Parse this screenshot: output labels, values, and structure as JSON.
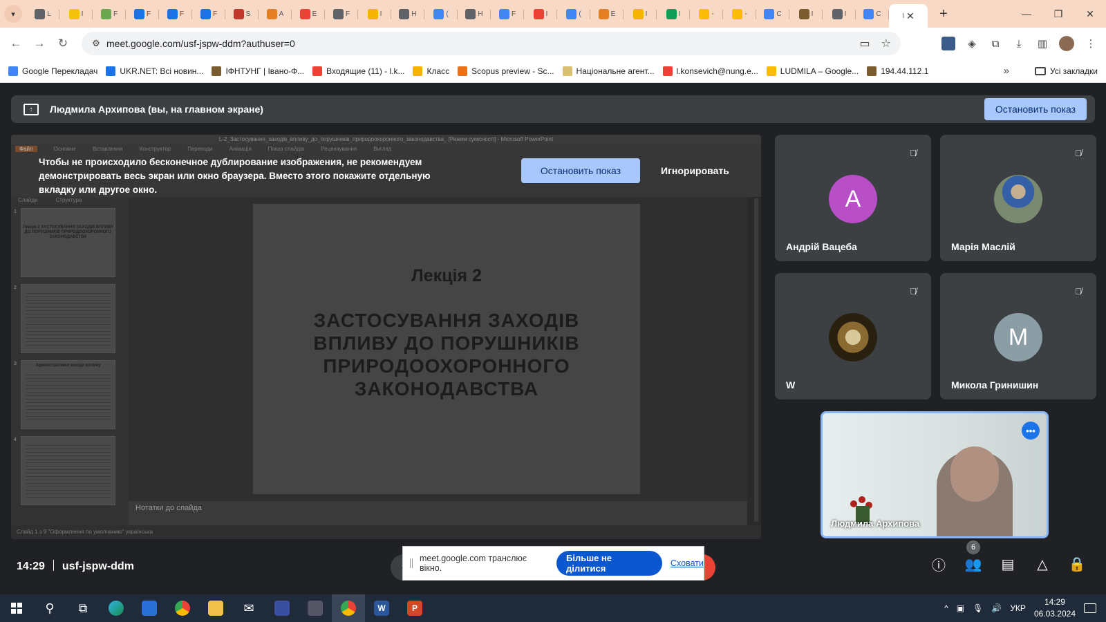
{
  "browser": {
    "tabs": [
      {
        "icon": "chrome-icon",
        "letter": "L",
        "color": "#5f6368"
      },
      {
        "icon": "yellow-doc-icon",
        "letter": "I",
        "color": "#f4c20d"
      },
      {
        "icon": "folder-doc-icon",
        "letter": "F",
        "color": "#6aa84f"
      },
      {
        "icon": "outlook-icon",
        "letter": "F",
        "color": "#1a73e8"
      },
      {
        "icon": "outlook-icon",
        "letter": "F",
        "color": "#1a73e8"
      },
      {
        "icon": "outlook-icon",
        "letter": "F",
        "color": "#1a73e8"
      },
      {
        "icon": "thermometer-icon",
        "letter": "S",
        "color": "#c0392b"
      },
      {
        "icon": "egg-icon",
        "letter": "A",
        "color": "#e67e22"
      },
      {
        "icon": "gmail-icon",
        "letter": "E",
        "color": "#ea4335"
      },
      {
        "icon": "dark-gear-icon",
        "letter": "F",
        "color": "#5f6368"
      },
      {
        "icon": "classroom-icon",
        "letter": "I",
        "color": "#f4b400"
      },
      {
        "icon": "chrome-icon",
        "letter": "H",
        "color": "#5f6368"
      },
      {
        "icon": "translate-icon",
        "letter": "(",
        "color": "#4285f4"
      },
      {
        "icon": "chrome-icon",
        "letter": "H",
        "color": "#5f6368"
      },
      {
        "icon": "forms-icon",
        "letter": "F",
        "color": "#4285f4"
      },
      {
        "icon": "google-icon",
        "letter": "I",
        "color": "#ea4335"
      },
      {
        "icon": "translate-icon",
        "letter": "(",
        "color": "#4285f4"
      },
      {
        "icon": "orange-icon",
        "letter": "E",
        "color": "#e67e22"
      },
      {
        "icon": "classroom-icon",
        "letter": "I",
        "color": "#f4b400"
      },
      {
        "icon": "sheets-plus-icon",
        "letter": "I",
        "color": "#0f9d58"
      },
      {
        "icon": "drive-icon",
        "letter": "-",
        "color": "#fbbc05"
      },
      {
        "icon": "drive-icon",
        "letter": "-",
        "color": "#fbbc05"
      },
      {
        "icon": "translate-icon",
        "letter": "C",
        "color": "#4285f4"
      },
      {
        "icon": "crest-icon",
        "letter": "I",
        "color": "#7b5c2e"
      },
      {
        "icon": "chrome-icon",
        "letter": "I",
        "color": "#5f6368"
      },
      {
        "icon": "calendar-icon",
        "letter": "C",
        "color": "#4285f4"
      }
    ],
    "active_tab_letter": "I",
    "url": "meet.google.com/usf-jspw-ddm?authuser=0",
    "bookmarks": [
      {
        "label": "Google Перекладач",
        "color": "#4285f4"
      },
      {
        "label": "UKR.NET: Всі новин...",
        "color": "#1a73e8"
      },
      {
        "label": "ІФНТУНГ | Івано-Ф...",
        "color": "#7b5c2e"
      },
      {
        "label": "Входящие (11) - l.k...",
        "color": "#ea4335"
      },
      {
        "label": "Класс",
        "color": "#f4b400"
      },
      {
        "label": "Scopus preview - Sc...",
        "color": "#e8711a"
      },
      {
        "label": "Національне агент...",
        "color": "#d8c070"
      },
      {
        "label": "l.konsevich@nung.e...",
        "color": "#ea4335"
      },
      {
        "label": "LUDMILA – Google...",
        "color": "#fbbc05"
      },
      {
        "label": "194.44.112.1",
        "color": "#7b5c2e"
      }
    ],
    "all_bookmarks": "Усі закладки"
  },
  "meet": {
    "presenting_label": "Людмила Архипова (вы, на главном экране)",
    "stop_presenting": "Остановить показ",
    "warning": "Чтобы не происходило бесконечное дублирование изображения, не рекомендуем демонстрировать весь экран или окно браузера. Вместо этого покажите отдельную вкладку или другое окно.",
    "warning_stop": "Остановить показ",
    "warning_ignore": "Игнорировать",
    "ppt_window_title": "L-2_Застосування_заходів_впливу_до_порушників_природоохоронного_законодавства_ [Режим сумісності] - Microsoft PowerPoint",
    "ppt_ribbon_tabs": [
      "Файл",
      "Основне",
      "Вставлення",
      "Конструктор",
      "Переходи",
      "Анімація",
      "Показ слайдів",
      "Рецензування",
      "Вигляд"
    ],
    "ppt_left_tabs": [
      "Слайди",
      "Структура"
    ],
    "slide_title": "Лекція 2",
    "slide_subtitle": "ЗАСТОСУВАННЯ ЗАХОДІВ ВПЛИВУ ДО ПОРУШНИКІВ ПРИРОДООХОРОННОГО ЗАКОНОДАВСТВА",
    "thumb1_text": "Лекція 2 ЗАСТОСУВАННЯ ЗАХОДІВ ВПЛИВУ ДО ПОРУШНИКІВ ПРИРОДООХОРОННОГО ЗАКОНОДАВСТВА",
    "thumb3_text": "Адміністративні заходи впливу",
    "notes_placeholder": "Нотатки до слайда",
    "ppt_status": "Слайд 1 з 9   \"Оформлення по умолчанию\"   українська",
    "participants": [
      {
        "name": "Андрій Вацеба",
        "initial": "A",
        "avatar_color": "#b94fc7",
        "avatar_type": "letter"
      },
      {
        "name": "Марія Маслій",
        "initial": "",
        "avatar_color": "#7a8a70",
        "avatar_type": "photo"
      },
      {
        "name": "W",
        "initial": "",
        "avatar_color": "#5a4a20",
        "avatar_type": "photo"
      },
      {
        "name": "Микола Гринишин",
        "initial": "M",
        "avatar_color": "#8c9ea5",
        "avatar_type": "letter"
      }
    ],
    "self_name": "Людмила Архипова",
    "time": "14:29",
    "meeting_code": "usf-jspw-ddm",
    "share_notice": "meet.google.com транслює вікно.",
    "share_stop": "Більше не ділитися",
    "share_hide": "Сховати",
    "people_count": "6"
  },
  "taskbar": {
    "language": "УКР",
    "time": "14:29",
    "date": "06.03.2024"
  }
}
